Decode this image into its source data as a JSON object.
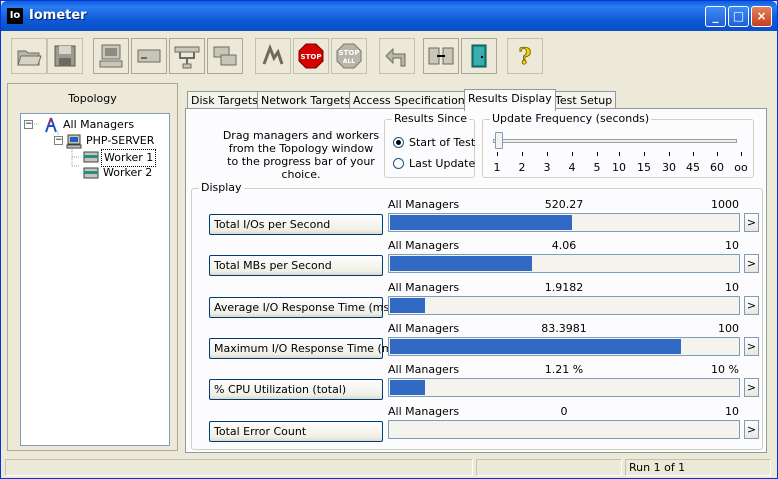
{
  "window": {
    "title": "Iometer",
    "icon_text": "Io",
    "minimize": "_",
    "maximize": "□",
    "close": "×"
  },
  "toolbar": {
    "buttons": [
      "open-config-icon",
      "save-config-icon",
      "start-manager-icon",
      "start-disk-worker-icon",
      "start-network-worker-icon",
      "duplicate-worker-icon",
      "start-tests-icon",
      "stop-test-icon",
      "stop-all-icon",
      "reset-workers-icon",
      "exit-icon",
      "exit-door-icon",
      "about-icon"
    ],
    "stop_label": "STOP",
    "stop_all_label": "STOP",
    "stop_all_sub": "ALL",
    "about_label": "?"
  },
  "topology": {
    "title": "Topology",
    "nodes": [
      {
        "label": "All Managers",
        "expander": "−"
      },
      {
        "label": "PHP-SERVER",
        "expander": "−"
      },
      {
        "label": "Worker 1"
      },
      {
        "label": "Worker 2"
      }
    ]
  },
  "tabs": [
    "Disk Targets",
    "Network Targets",
    "Access Specifications",
    "Results Display",
    "Test Setup"
  ],
  "results": {
    "drag_text": [
      "Drag managers and workers",
      "from the Topology window",
      "to the progress bar of your choice."
    ],
    "results_since": {
      "title": "Results Since",
      "options": [
        "Start of Test",
        "Last Update"
      ],
      "selected": "Start of Test"
    },
    "update_frequency": {
      "title": "Update Frequency (seconds)",
      "ticks": [
        "1",
        "2",
        "3",
        "4",
        "5",
        "10",
        "15",
        "30",
        "45",
        "60",
        "oo"
      ],
      "selected": "1"
    },
    "display_title": "Display",
    "rows": [
      {
        "label": "Total I/Os per Second",
        "manager": "All Managers",
        "value": "520.27",
        "max": "1000",
        "fraction": 0.52
      },
      {
        "label": "Total MBs per Second",
        "manager": "All Managers",
        "value": "4.06",
        "max": "10",
        "fraction": 0.406
      },
      {
        "label": "Average I/O Response Time (ms)",
        "manager": "All Managers",
        "value": "1.9182",
        "max": "10",
        "fraction": 0.1
      },
      {
        "label": "Maximum I/O Response Time (ms)",
        "manager": "All Managers",
        "value": "83.3981",
        "max": "100",
        "fraction": 0.83
      },
      {
        "label": "% CPU Utilization (total)",
        "manager": "All Managers",
        "value": "1.21 %",
        "max": "10 %",
        "fraction": 0.1
      },
      {
        "label": "Total Error Count",
        "manager": "All Managers",
        "value": "0",
        "max": "10",
        "fraction": 0
      }
    ],
    "arrow": ">"
  },
  "status": {
    "run": "Run 1 of 1"
  },
  "colors": {
    "bar": "#316ac5",
    "title_bar": "#0a5fde"
  }
}
